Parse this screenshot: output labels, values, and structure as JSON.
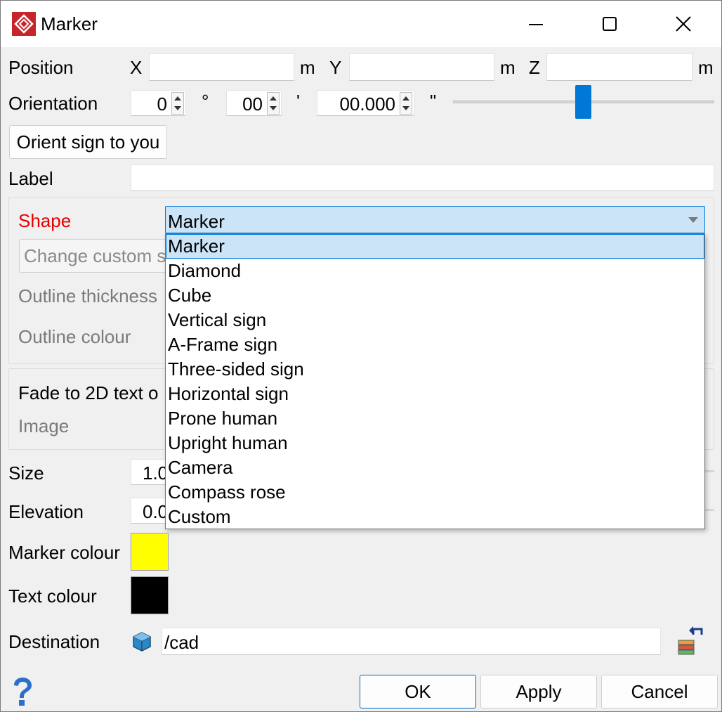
{
  "window": {
    "title": "Marker"
  },
  "position": {
    "label": "Position",
    "x_label": "X",
    "y_label": "Y",
    "z_label": "Z",
    "x_value": "",
    "y_value": "",
    "z_value": "",
    "unit": "m"
  },
  "orientation": {
    "label": "Orientation",
    "degrees": "0",
    "deg_symbol": "°",
    "minutes": "00",
    "min_symbol": "'",
    "seconds": "00.000",
    "sec_symbol": "\""
  },
  "orient_button": "Orient sign to you",
  "label_field": {
    "label": "Label",
    "value": ""
  },
  "shape": {
    "label": "Shape",
    "selected": "Marker",
    "options": [
      "Marker",
      "Diamond",
      "Cube",
      "Vertical sign",
      "A-Frame sign",
      "Three-sided sign",
      "Horizontal sign",
      "Prone human",
      "Upright human",
      "Camera",
      "Compass rose",
      "Custom"
    ],
    "change_custom": "Change custom s",
    "outline_thickness": "Outline thickness",
    "outline_colour": "Outline colour"
  },
  "fade": {
    "label": "Fade to 2D text o",
    "image_label": "Image"
  },
  "size": {
    "label": "Size",
    "value": "1.0"
  },
  "elevation": {
    "label": "Elevation",
    "value": "0.0"
  },
  "marker_colour": {
    "label": "Marker colour",
    "color": "#ffff00"
  },
  "text_colour": {
    "label": "Text colour",
    "color": "#000000"
  },
  "destination": {
    "label": "Destination",
    "value": "/cad"
  },
  "buttons": {
    "ok": "OK",
    "apply": "Apply",
    "cancel": "Cancel"
  },
  "colors": {
    "accent": "#0078d7",
    "selection_bg": "#cce4f7",
    "shape_label": "#e80000"
  }
}
